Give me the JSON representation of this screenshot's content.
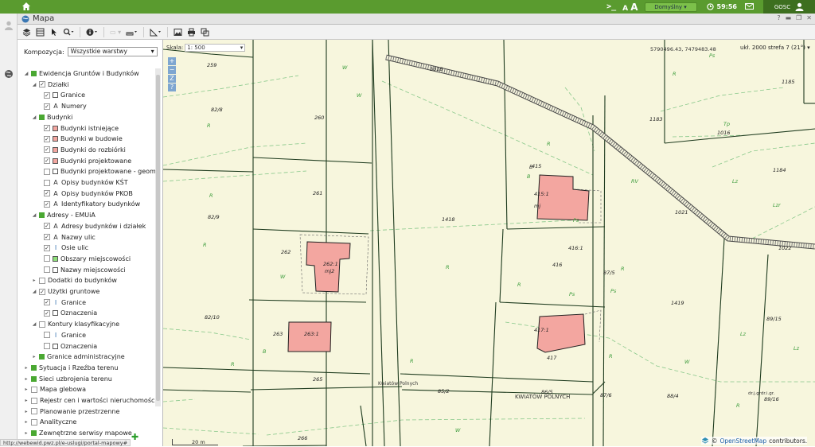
{
  "topbar": {
    "accent": "#5a9b2f",
    "terminal_icon": "terminal-icon",
    "font_small": "A",
    "font_big": "A",
    "profile": "Domyślny",
    "clock": "59:56",
    "user": "GOSC"
  },
  "window": {
    "title": "Mapa"
  },
  "composition": {
    "label": "Kompozycja:",
    "value": "Wszystkie warstwy"
  },
  "map": {
    "scale_label": "Skala:",
    "scale_value": "1: 500",
    "coords": "5790496.43, 7479483.48",
    "crs": "ukł. 2000 strefa 7 (21°)",
    "attribution_prefix": "©",
    "attribution_link": "OpenStreetMap",
    "attribution_suffix": "contributors.",
    "scale_bar": "20 m"
  },
  "status_url": "http://webewid.pwz.pl/e-uslugi/portal-mapowy#",
  "tree": [
    {
      "label": "Ewidencja Gruntów i Budynków",
      "level": 0,
      "toggle": "◢",
      "check": "sq-green"
    },
    {
      "label": "Działki",
      "level": 1,
      "toggle": "◢",
      "check": "✓"
    },
    {
      "label": "Granice",
      "level": 2,
      "check": "✓",
      "sym": "sq-white"
    },
    {
      "label": "Numery",
      "level": 2,
      "check": "✓",
      "sym": "A"
    },
    {
      "label": "Budynki",
      "level": 1,
      "toggle": "◢",
      "check": "sq-green"
    },
    {
      "label": "Budynki istniejące",
      "level": 2,
      "check": "✓",
      "sym": "sq-red"
    },
    {
      "label": "Budynki w budowie",
      "level": 2,
      "check": "✓",
      "sym": "sq-red"
    },
    {
      "label": "Budynki do rozbiórki",
      "level": 2,
      "check": "✓",
      "sym": "sq-red"
    },
    {
      "label": "Budynki projektowane",
      "level": 2,
      "check": "✓",
      "sym": "sq-red"
    },
    {
      "label": "Budynki projektowane - geom",
      "level": 2,
      "check": "",
      "sym": "sq-white"
    },
    {
      "label": "Opisy budynków KŚT",
      "level": 2,
      "check": "",
      "sym": "A"
    },
    {
      "label": "Opisy budynków PKOB",
      "level": 2,
      "check": "✓",
      "sym": "A"
    },
    {
      "label": "Identyfikatory budynków",
      "level": 2,
      "check": "✓",
      "sym": "A"
    },
    {
      "label": "Adresy - EMUiA",
      "level": 1,
      "toggle": "◢",
      "check": "sq-green"
    },
    {
      "label": "Adresy budynków i działek",
      "level": 2,
      "check": "✓",
      "sym": "A"
    },
    {
      "label": "Nazwy ulic",
      "level": 2,
      "check": "✓",
      "sym": "A"
    },
    {
      "label": "Osie ulic",
      "level": 2,
      "check": "✓",
      "sym": "I"
    },
    {
      "label": "Obszary miejscowości",
      "level": 2,
      "check": "",
      "sym": "sq-lgreen"
    },
    {
      "label": "Nazwy miejscowości",
      "level": 2,
      "check": "",
      "sym": "sq-white"
    },
    {
      "label": "Dodatki do budynków",
      "level": 1,
      "toggle": "▸",
      "check": ""
    },
    {
      "label": "Użytki gruntowe",
      "level": 1,
      "toggle": "◢",
      "check": "✓"
    },
    {
      "label": "Granice",
      "level": 2,
      "check": "✓",
      "sym": "I"
    },
    {
      "label": "Oznaczenia",
      "level": 2,
      "check": "✓",
      "sym": "sq-white"
    },
    {
      "label": "Kontury klasyfikacyjne",
      "level": 1,
      "toggle": "◢",
      "check": ""
    },
    {
      "label": "Granice",
      "level": 2,
      "check": "",
      "sym": "I"
    },
    {
      "label": "Oznaczenia",
      "level": 2,
      "check": "",
      "sym": "sq-white"
    },
    {
      "label": "Granice administracyjne",
      "level": 1,
      "toggle": "▸",
      "check": "sq-green"
    },
    {
      "label": "Sytuacja i Rzeźba terenu",
      "level": 0,
      "toggle": "▸",
      "check": "sq-green"
    },
    {
      "label": "Sieci uzbrojenia terenu",
      "level": 0,
      "toggle": "▸",
      "check": "sq-green"
    },
    {
      "label": "Mapa glebowa",
      "level": 0,
      "toggle": "▸",
      "check": ""
    },
    {
      "label": "Rejestr cen i wartości nieruchomości",
      "level": 0,
      "toggle": "▸",
      "check": ""
    },
    {
      "label": "Planowanie przestrzenne",
      "level": 0,
      "toggle": "▸",
      "check": ""
    },
    {
      "label": "Analityczne",
      "level": 0,
      "toggle": "▸",
      "check": ""
    },
    {
      "label": "Zewnętrzne serwisy mapowe",
      "level": 0,
      "toggle": "▸",
      "check": "sq-green"
    }
  ],
  "parcels": [
    "259",
    "82/8",
    "260",
    "1018",
    "1183",
    "1016",
    "1185",
    "415",
    "415:1",
    "mj",
    "B",
    "1184",
    "1021",
    "1418",
    "261",
    "82/9",
    "262",
    "262:1",
    "mj2",
    "416",
    "416:1",
    "87/5",
    "1419",
    "89/15",
    "82/10",
    "263",
    "263:1",
    "417:1",
    "417",
    "265",
    "85/2",
    "86/5",
    "87/6",
    "88/4",
    "89/16",
    "266",
    "1022",
    "Ps",
    "R",
    "W",
    "Lz",
    "Lzr",
    "Tp",
    "RV"
  ],
  "streets": [
    "Kwiatów Polnych",
    "KWIATÓW POLNYCH",
    "dr.j.grdr.i.gr."
  ]
}
